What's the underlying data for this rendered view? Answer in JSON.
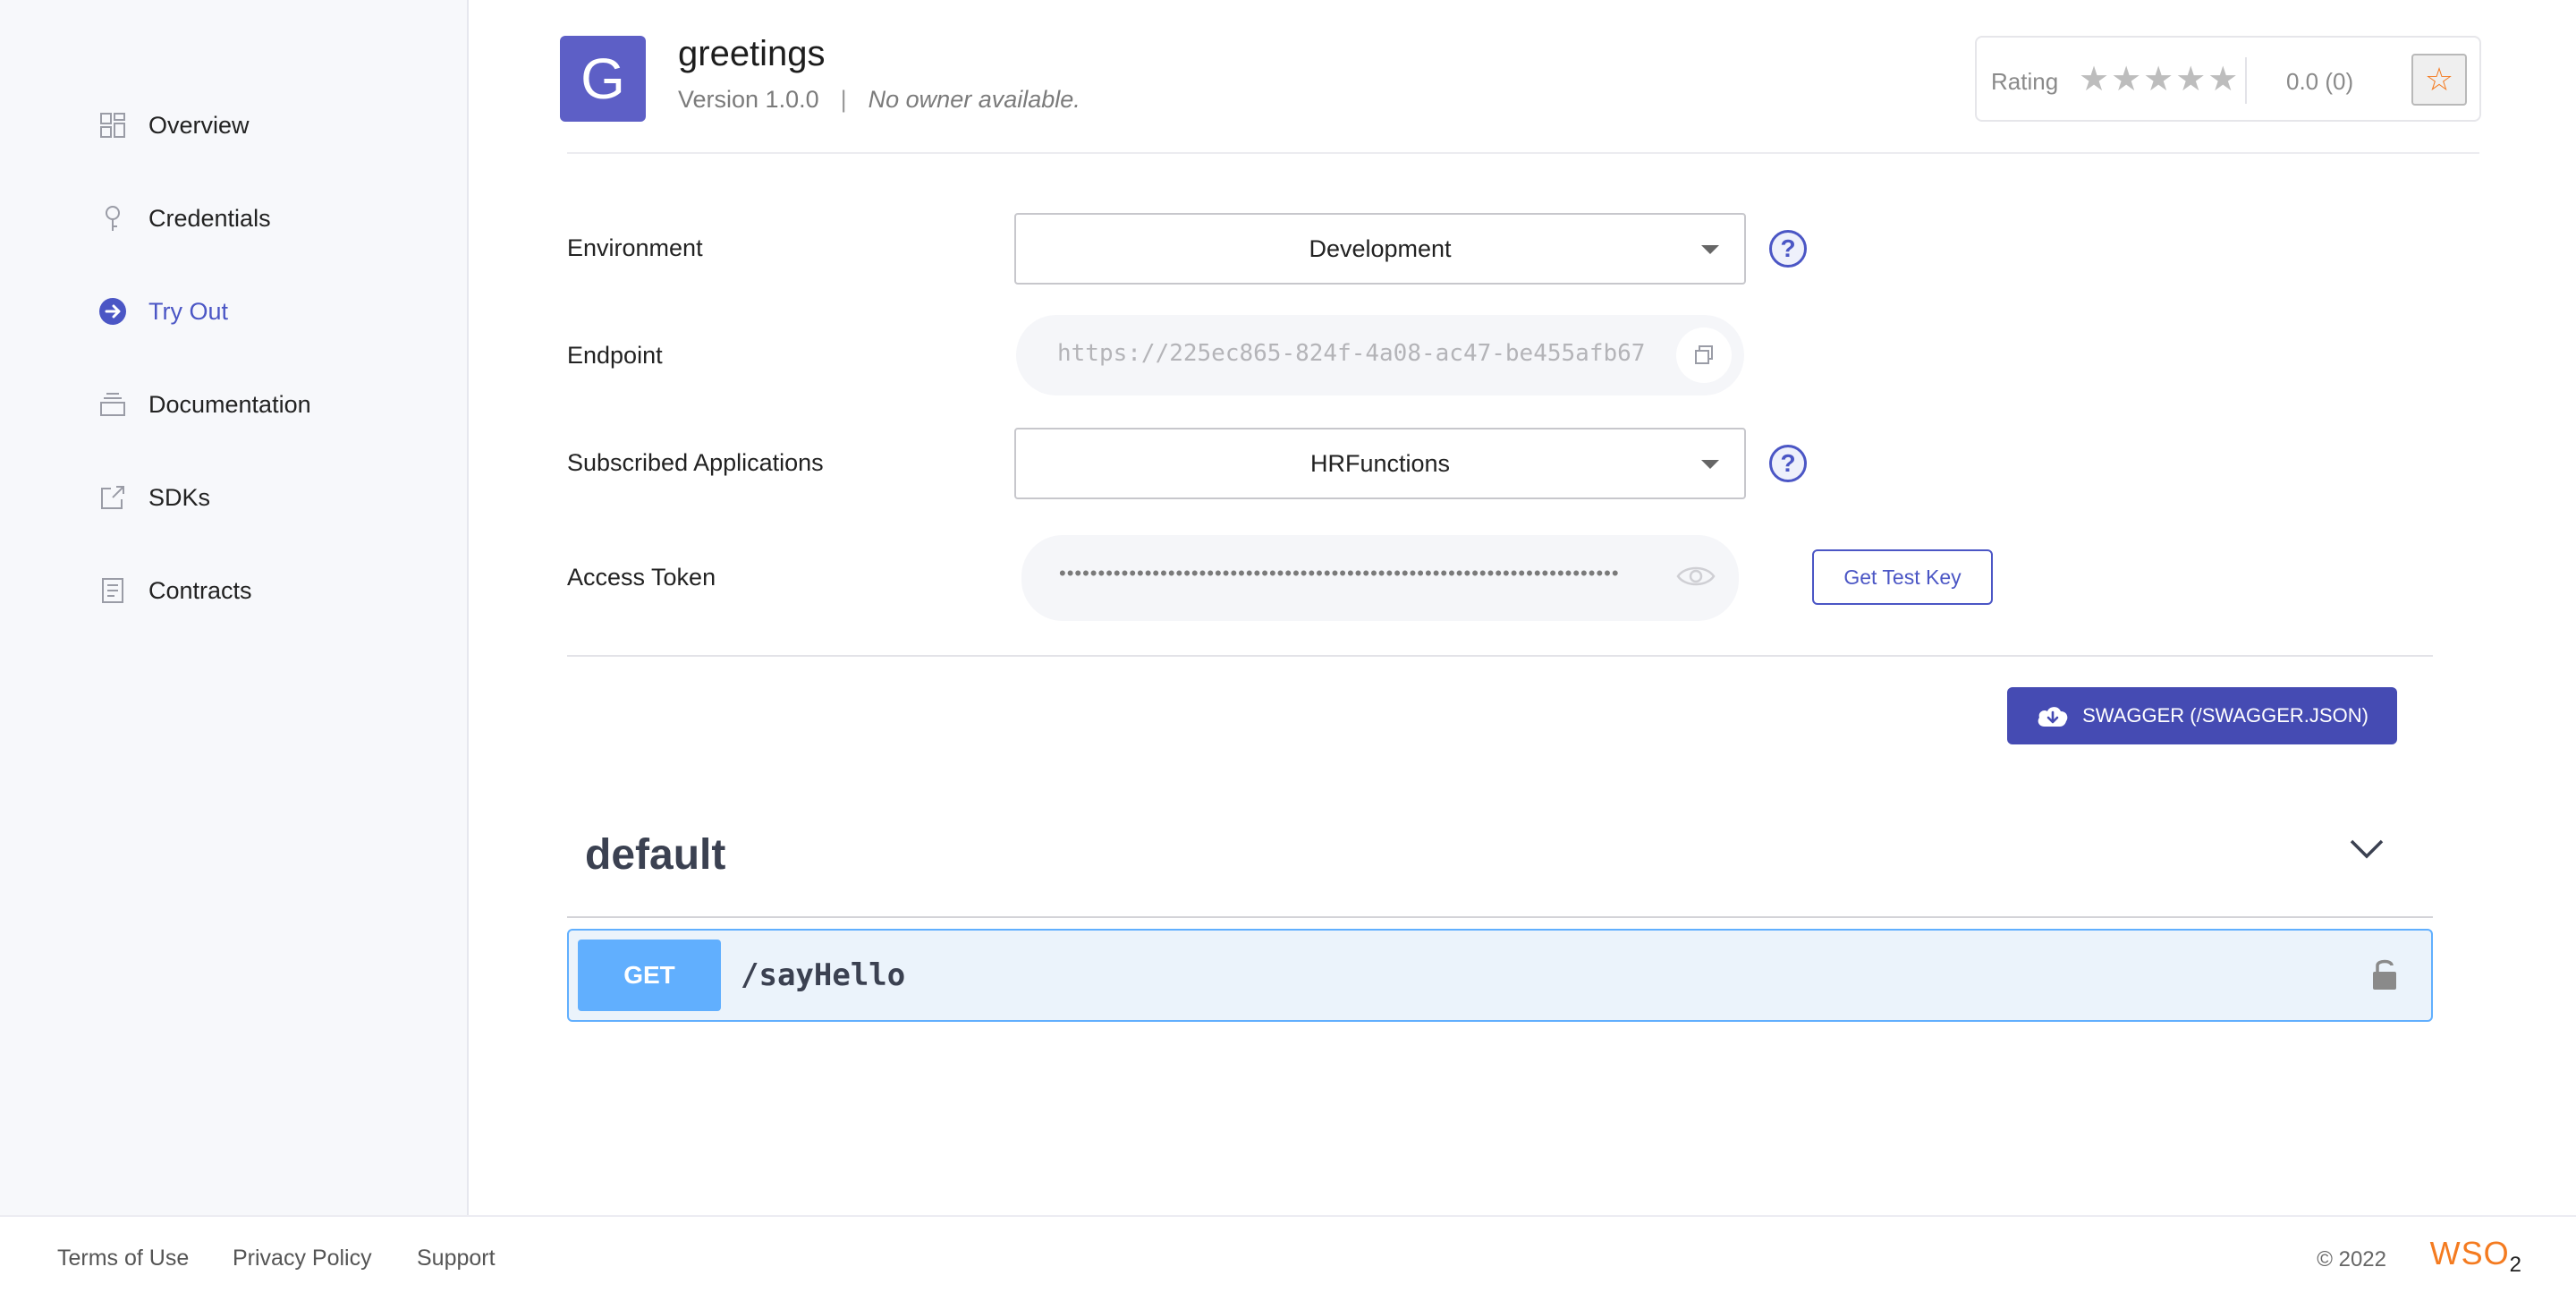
{
  "sidebar": {
    "items": [
      {
        "label": "Overview",
        "icon": "grid-icon"
      },
      {
        "label": "Credentials",
        "icon": "key-icon"
      },
      {
        "label": "Try Out",
        "icon": "arrow-right-circle-icon"
      },
      {
        "label": "Documentation",
        "icon": "stack-icon"
      },
      {
        "label": "SDKs",
        "icon": "external-box-icon"
      },
      {
        "label": "Contracts",
        "icon": "document-icon"
      }
    ],
    "active": "Try Out"
  },
  "header": {
    "logo_letter": "G",
    "api_name": "greetings",
    "version": "Version 1.0.0",
    "separator": "|",
    "owner": "No owner available.",
    "rating_label": "Rating",
    "stars": "★★★★★",
    "rating_value": "0.0 (0)",
    "rate_button_icon": "☆"
  },
  "form": {
    "environment_label": "Environment",
    "environment_value": "Development",
    "endpoint_label": "Endpoint",
    "endpoint_value": "https://225ec865-824f-4a08-ac47-be455afb67",
    "subscribed_label": "Subscribed Applications",
    "subscribed_value": "HRFunctions",
    "help_icon": "?",
    "token_label": "Access Token",
    "token_value": "••••••••••••••••••••••••••••••••••••••••••••••••••••••••••••••••••••••••",
    "get_test_key": "Get Test Key"
  },
  "swagger": {
    "download_label": "SWAGGER (/SWAGGER.JSON)",
    "tag": "default",
    "operations": [
      {
        "method": "GET",
        "path": "/sayHello"
      }
    ]
  },
  "footer": {
    "terms": "Terms of Use",
    "privacy": "Privacy Policy",
    "support": "Support",
    "copyright": "© 2022",
    "brand": "WSO",
    "brand_sub": "2"
  },
  "colors": {
    "accent": "#4b56c5",
    "swagger_get": "#61affe",
    "brand_orange": "#f47b20"
  }
}
